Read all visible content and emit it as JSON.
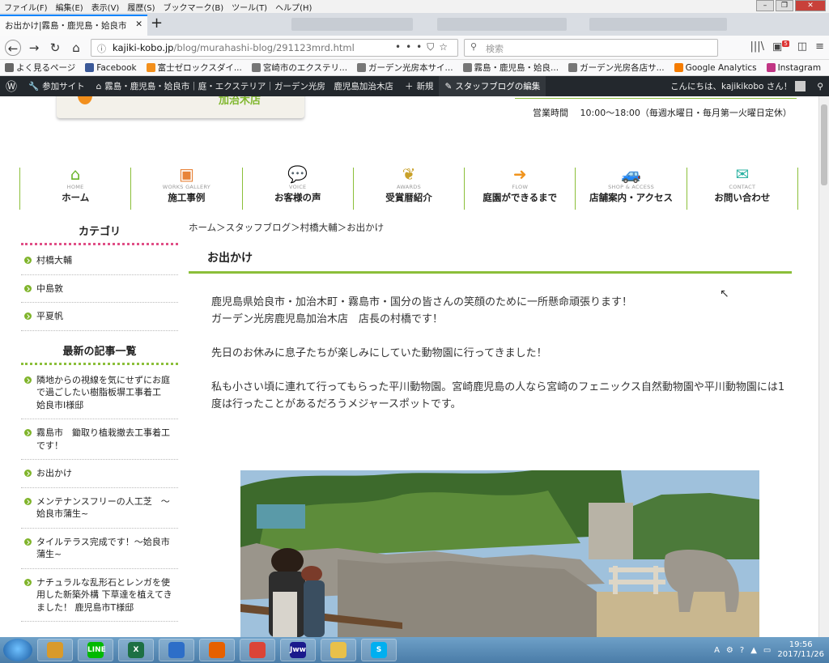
{
  "browser": {
    "menu": [
      "ファイル(F)",
      "編集(E)",
      "表示(V)",
      "履歴(S)",
      "ブックマーク(B)",
      "ツール(T)",
      "ヘルプ(H)"
    ],
    "active_tab": "お出かけ|霧島・鹿児島・姶良市",
    "url_host": "kajiki-kobo.jp",
    "url_path": "/blog/murahashi-blog/291123mrd.html",
    "search_placeholder": "検索",
    "badge": "5"
  },
  "bookmarks": [
    {
      "label": "よく見るページ",
      "icon": "gear-icon",
      "color": "#666666"
    },
    {
      "label": "Facebook",
      "icon": "facebook-icon",
      "color": "#3b5998"
    },
    {
      "label": "富士ゼロックスダイ...",
      "icon": "fujixerox-icon",
      "color": "#f28f1c"
    },
    {
      "label": "宮崎市のエクステリ...",
      "icon": "globe-icon",
      "color": "#777777"
    },
    {
      "label": "ガーデン光房本サイ...",
      "icon": "globe-icon",
      "color": "#777777"
    },
    {
      "label": "霧島・鹿児島・姶良...",
      "icon": "globe-icon",
      "color": "#777777"
    },
    {
      "label": "ガーデン光房各店サ...",
      "icon": "globe-icon",
      "color": "#777777"
    },
    {
      "label": "Google Analytics",
      "icon": "analytics-icon",
      "color": "#f57c00"
    },
    {
      "label": "Instagram",
      "icon": "instagram-icon",
      "color": "#c13584"
    }
  ],
  "wpbar": {
    "participating_site": "参加サイト",
    "site_name": "霧島・鹿児島・姶良市｜庭・エクステリア｜ガーデン光房　鹿児島加治木店",
    "new": "新規",
    "edit": "スタッフブログの編集",
    "greeting": "こんにちは、kajikikobo さん！"
  },
  "site": {
    "logo_sub": "加治木店",
    "hours": "営業時間　 10:00～18:00（毎週水曜日・毎月第一火曜日定休）"
  },
  "nav": [
    {
      "en": "HOME",
      "jp": "ホーム",
      "icon": "house-icon",
      "color": "#6bb52c"
    },
    {
      "en": "WORKS GALLERY",
      "jp": "施工事例",
      "icon": "gallery-icon",
      "color": "#e8843a"
    },
    {
      "en": "VOICE",
      "jp": "お客様の声",
      "icon": "speech-bubble-icon",
      "color": "#e8578a"
    },
    {
      "en": "AWARDS",
      "jp": "受賞暦紹介",
      "icon": "laurel-icon",
      "color": "#c9a12a"
    },
    {
      "en": "FLOW",
      "jp": "庭園ができるまで",
      "icon": "arrow-right-icon",
      "color": "#f0941d"
    },
    {
      "en": "SHOP & ACCESS",
      "jp": "店舗案内・アクセス",
      "icon": "car-icon",
      "color": "#4a8fd0"
    },
    {
      "en": "CONTACT",
      "jp": "お問い合わせ",
      "icon": "mail-icon",
      "color": "#2db3a3"
    }
  ],
  "sidebar": {
    "category_heading": "カテゴリ",
    "categories": [
      "村橋大輔",
      "中島敦",
      "平夏帆"
    ],
    "recent_heading": "最新の記事一覧",
    "recent": [
      "隣地からの視線を気にせずにお庭で過ごしたい樹脂板塀工事着工　姶良市I様邸",
      "霧島市　鋤取り植栽撤去工事着工です！",
      "お出かけ",
      "メンテナンスフリーの人工芝　～姶良市蒲生~",
      "タイルテラス完成です！～姶良市蒲生~",
      "ナチュラルな乱形石とレンガを使用した新築外構 下草達を植えてきました！ 鹿児島市T様邸"
    ]
  },
  "post": {
    "breadcrumb": "ホーム＞スタッフブログ＞村橋大輔＞お出かけ",
    "title": "お出かけ",
    "paragraphs": [
      "鹿児島県姶良市・加治木町・霧島市・国分の皆さんの笑顔のために一所懸命頑張ります！\nガーデン光房鹿児島加治木店　店長の村橋です！",
      "先日のお休みに息子たちが楽しみにしていた動物園に行ってきました！",
      "私も小さい頃に連れて行ってもらった平川動物園。宮崎鹿児島の人なら宮崎のフェニックス自然動物園や平川動物園には1度は行ったことがあるだろうメジャースポットです。"
    ]
  },
  "taskbar": {
    "apps": [
      {
        "name": "explorer-search-icon",
        "label": "",
        "color": "#d99a2b"
      },
      {
        "name": "line-icon",
        "label": "LINE",
        "color": "#00b900"
      },
      {
        "name": "excel-icon",
        "label": "X",
        "color": "#1d7044"
      },
      {
        "name": "thunderbird-icon",
        "label": "",
        "color": "#2d6ec8"
      },
      {
        "name": "firefox-icon",
        "label": "",
        "color": "#e66000"
      },
      {
        "name": "chrome-icon",
        "label": "",
        "color": "#db4437"
      },
      {
        "name": "jww-icon",
        "label": "Jww",
        "color": "#1a1a8c"
      },
      {
        "name": "folder-icon",
        "label": "",
        "color": "#e8c04a"
      },
      {
        "name": "skype-icon",
        "label": "S",
        "color": "#00aff0"
      }
    ],
    "time": "19:56",
    "date": "2017/11/26"
  }
}
